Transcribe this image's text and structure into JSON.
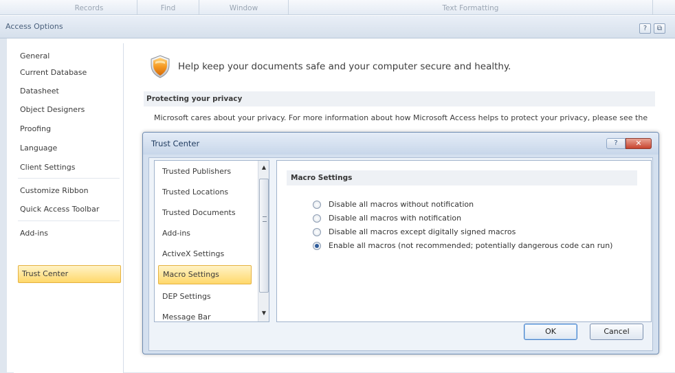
{
  "ribbon": {
    "groups": [
      "Records",
      "Find",
      "Window",
      "Text Formatting"
    ]
  },
  "window": {
    "title": "Access Options",
    "help_glyph": "?",
    "restore_glyph": "⧉"
  },
  "nav": {
    "items": [
      "General",
      "Current Database",
      "Datasheet",
      "Object Designers",
      "Proofing",
      "Language",
      "Client Settings",
      "Customize Ribbon",
      "Quick Access Toolbar",
      "Add-ins",
      "Trust Center"
    ],
    "selected": "Trust Center"
  },
  "main": {
    "help_text": "Help keep your documents safe and your computer secure and healthy.",
    "privacy_header": "Protecting your privacy",
    "privacy_text": "Microsoft cares about your privacy. For more information about how Microsoft Access helps to protect your privacy, please see the privacy statements."
  },
  "trust_center": {
    "title": "Trust Center",
    "help_glyph": "?",
    "close_glyph": "✕",
    "list": [
      "Trusted Publishers",
      "Trusted Locations",
      "Trusted Documents",
      "Add-ins",
      "ActiveX Settings",
      "Macro Settings",
      "DEP Settings",
      "Message Bar"
    ],
    "selected": "Macro Settings",
    "section_header": "Macro Settings",
    "options": [
      {
        "label": "Disable all macros without notification",
        "checked": false
      },
      {
        "label": "Disable all macros with notification",
        "checked": false
      },
      {
        "label": "Disable all macros except digitally signed macros",
        "checked": false
      },
      {
        "label": "Enable all macros (not recommended; potentially dangerous code can run)",
        "checked": true
      }
    ],
    "ok_label": "OK",
    "cancel_label": "Cancel"
  },
  "colors": {
    "selection_fill": "#ffd86b",
    "selection_border": "#e5b13f",
    "close_red": "#c7432e",
    "shield_orange": "#f08c1a"
  }
}
